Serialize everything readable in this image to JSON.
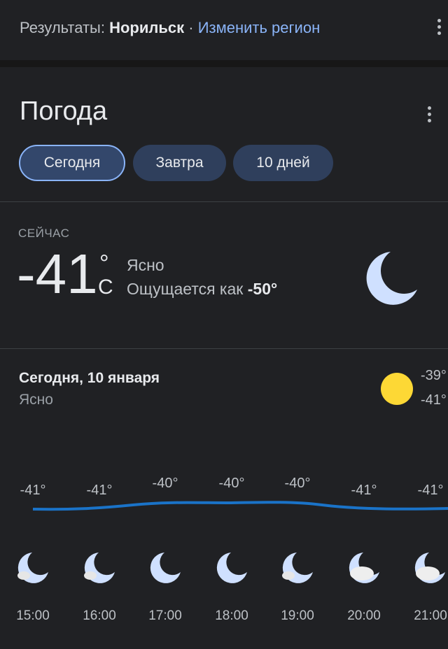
{
  "header": {
    "prefix": "Результаты: ",
    "city": "Норильск",
    "separator": " · ",
    "change_region": "Изменить регион"
  },
  "weather": {
    "title": "Погода",
    "tabs": [
      {
        "label": "Сегодня",
        "active": true
      },
      {
        "label": "Завтра",
        "active": false
      },
      {
        "label": "10 дней",
        "active": false
      }
    ],
    "now": {
      "label": "СЕЙЧАС",
      "temp": "-41",
      "degree": "°",
      "unit": "C",
      "condition": "Ясно",
      "feels_like_label": "Ощущается как ",
      "feels_like_value": "-50°",
      "icon": "moon-icon"
    },
    "day": {
      "title": "Сегодня, 10 января",
      "condition": "Ясно",
      "high": "-39°",
      "low": "-41°",
      "icon": "sun-icon"
    },
    "hourly": [
      {
        "time": "15:00",
        "temp": "-41°",
        "icon": "moon-cloud-icon"
      },
      {
        "time": "16:00",
        "temp": "-41°",
        "icon": "moon-cloud-icon"
      },
      {
        "time": "17:00",
        "temp": "-40°",
        "icon": "moon-icon"
      },
      {
        "time": "18:00",
        "temp": "-40°",
        "icon": "moon-icon"
      },
      {
        "time": "19:00",
        "temp": "-40°",
        "icon": "moon-cloud-icon"
      },
      {
        "time": "20:00",
        "temp": "-41°",
        "icon": "moon-cloudy-icon"
      },
      {
        "time": "21:00",
        "temp": "-41°",
        "icon": "moon-cloudy-icon"
      }
    ]
  },
  "colors": {
    "background": "#202124",
    "link": "#8ab4f8",
    "chip": "#2f3f5c",
    "temp_line": "#1a73c8",
    "moon": "#cfe0ff",
    "sun": "#fdd835"
  }
}
